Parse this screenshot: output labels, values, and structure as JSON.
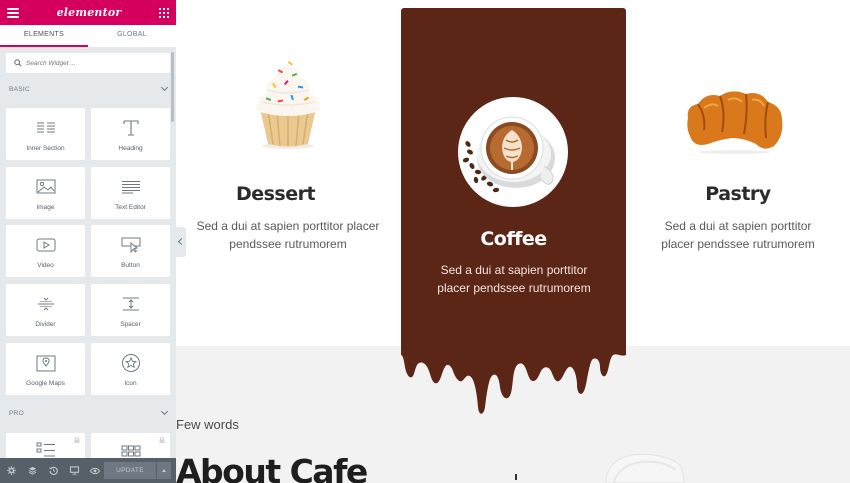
{
  "panel": {
    "logo": "elementor",
    "tabs": [
      "ELEMENTS",
      "GLOBAL"
    ],
    "search_placeholder": "Search Widget ...",
    "categories": {
      "basic": "BASIC",
      "pro": "PRO"
    },
    "widgets": [
      {
        "label": "Inner Section",
        "icon": "columns-icon"
      },
      {
        "label": "Heading",
        "icon": "heading-icon"
      },
      {
        "label": "Image",
        "icon": "image-icon"
      },
      {
        "label": "Text Editor",
        "icon": "text-editor-icon"
      },
      {
        "label": "Video",
        "icon": "video-icon"
      },
      {
        "label": "Button",
        "icon": "button-icon"
      },
      {
        "label": "Divider",
        "icon": "divider-icon"
      },
      {
        "label": "Spacer",
        "icon": "spacer-icon"
      },
      {
        "label": "Google Maps",
        "icon": "map-icon"
      },
      {
        "label": "Icon",
        "icon": "star-icon"
      }
    ],
    "footer": {
      "update_label": "UPDATE"
    },
    "colors": {
      "brand": "#d5005d",
      "footer": "#556068",
      "panel_bg": "#e6e9ec"
    }
  },
  "canvas": {
    "cards": [
      {
        "title": "Dessert",
        "text": "Sed a dui at sapien porttitor placer pendssee rutrumorem"
      },
      {
        "title": "Coffee",
        "text": "Sed a dui at sapien porttitor placer pendssee rutrumorem"
      },
      {
        "title": "Pastry",
        "text": "Sed a dui at sapien porttitor placer pendssee rutrumorem"
      }
    ],
    "few_words": "Few words",
    "about_heading": "About Cafe",
    "colors": {
      "coffee_card": "#5c2617",
      "section_bg": "#f2f2f2"
    }
  }
}
